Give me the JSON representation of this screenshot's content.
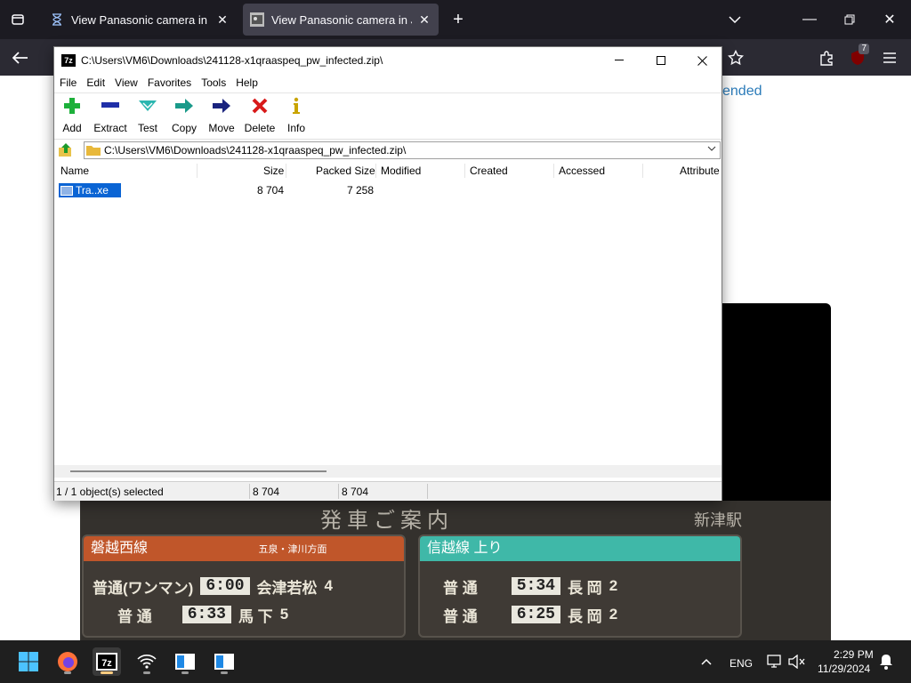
{
  "browser": {
    "tabs": [
      {
        "title": "View Panasonic camera in Japan",
        "active": false
      },
      {
        "title": "View Panasonic camera in Japan",
        "active": true
      }
    ],
    "extension_badge": "7"
  },
  "page": {
    "link_fragment": "ended",
    "sign": {
      "title": "発車ご案内",
      "station": "新津駅",
      "left_header": "磐越西線",
      "left_sub": "五泉・津川方面",
      "right_header": "信越線 上り",
      "left_rows": [
        {
          "type": "普通(ワンマン)",
          "time": "6:00",
          "dest": "会津若松",
          "track": "4"
        },
        {
          "type": "普 通",
          "time": "6:33",
          "dest": "馬 下",
          "track": "5"
        }
      ],
      "right_rows": [
        {
          "type": "普 通",
          "time": "5:34",
          "dest": "長 岡",
          "track": "2"
        },
        {
          "type": "普 通",
          "time": "6:25",
          "dest": "長 岡",
          "track": "2"
        }
      ]
    }
  },
  "zip": {
    "title": "C:\\Users\\VM6\\Downloads\\241128-x1qraaspeq_pw_infected.zip\\",
    "menu": [
      "File",
      "Edit",
      "View",
      "Favorites",
      "Tools",
      "Help"
    ],
    "toolbar": [
      "Add",
      "Extract",
      "Test",
      "Copy",
      "Move",
      "Delete",
      "Info"
    ],
    "path": "C:\\Users\\VM6\\Downloads\\241128-x1qraaspeq_pw_infected.zip\\",
    "columns": [
      "Name",
      "Size",
      "Packed Size",
      "Modified",
      "Created",
      "Accessed",
      "Attribute"
    ],
    "rows": [
      {
        "name": "Tra..xe",
        "size": "8 704",
        "packed": "7 258"
      }
    ],
    "status": {
      "selected": "1 / 1 object(s) selected",
      "size": "8 704",
      "packed": "8 704"
    }
  },
  "taskbar": {
    "language": "ENG",
    "time": "2:29 PM",
    "date": "11/29/2024"
  }
}
